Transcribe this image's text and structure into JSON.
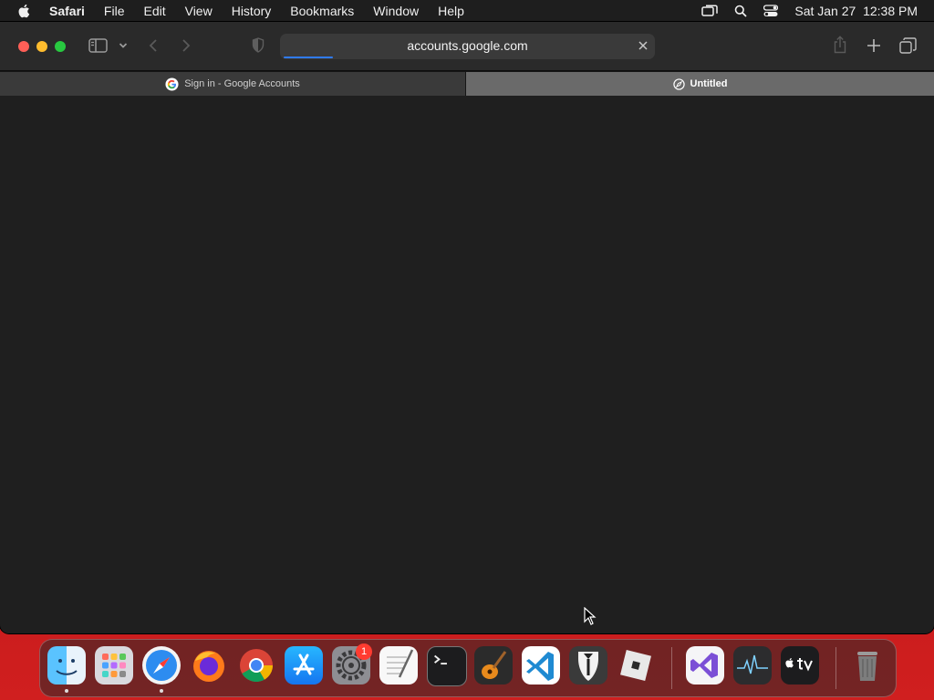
{
  "menubar": {
    "app_name": "Safari",
    "items": [
      "File",
      "Edit",
      "View",
      "History",
      "Bookmarks",
      "Window",
      "Help"
    ],
    "clock": "Sat Jan 27  12:38 PM"
  },
  "browser": {
    "address": "accounts.google.com",
    "tabs": [
      {
        "title": "Sign in - Google Accounts",
        "icon": "google-icon"
      },
      {
        "title": "Untitled",
        "icon": "compass-icon"
      }
    ]
  },
  "dock": {
    "apps": [
      "Finder",
      "Launchpad",
      "Safari",
      "Firefox",
      "Google Chrome",
      "App Store",
      "System Settings",
      "TextEdit",
      "Terminal",
      "GarageBand",
      "Visual Studio Code",
      "Bartender",
      "Roblox",
      "Visual Studio",
      "Activity Monitor",
      "Apple TV",
      "Trash"
    ],
    "settings_badge": "1"
  },
  "colors": {
    "accent": "#2f7bf5",
    "wallpaper": "#c0171a"
  }
}
